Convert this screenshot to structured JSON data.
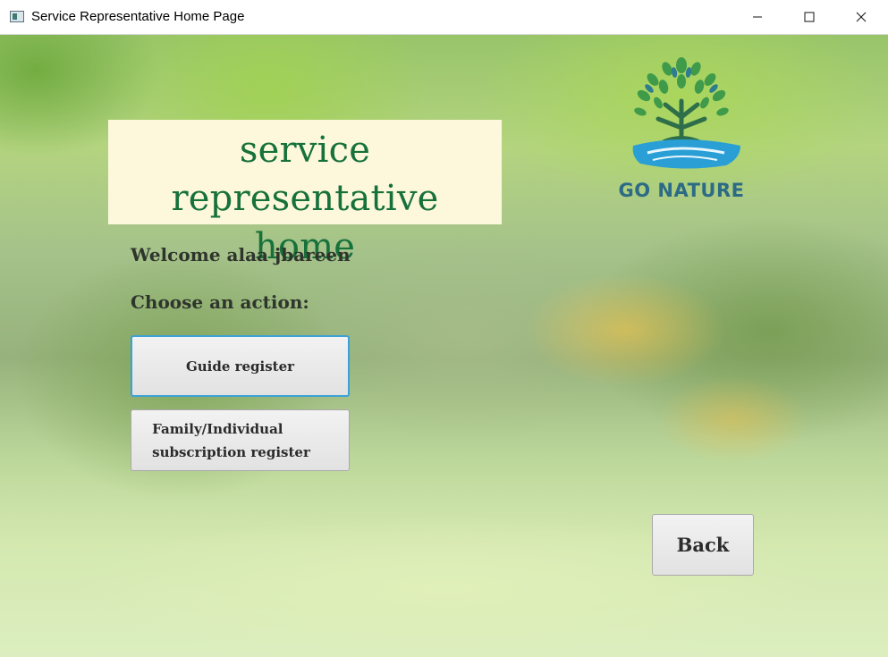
{
  "window": {
    "title": "Service Representative Home Page",
    "controls": {
      "minimize": "—",
      "maximize": "☐",
      "close": "✕"
    }
  },
  "header": {
    "title": "service representative\nhome",
    "title_color": "#17713a",
    "title_background": "#fdf8dc"
  },
  "logo": {
    "text": "GO NATURE",
    "icon": "tree-logo-icon"
  },
  "main": {
    "welcome": "Welcome alaa jbareen",
    "prompt": "Choose an action:",
    "actions": [
      {
        "label": "Guide register"
      },
      {
        "label": "Family/Individual\nsubscription register"
      }
    ]
  },
  "footer": {
    "back_label": "Back"
  },
  "colors": {
    "focus_border": "#3ba1d8",
    "text": "#2f352d"
  }
}
